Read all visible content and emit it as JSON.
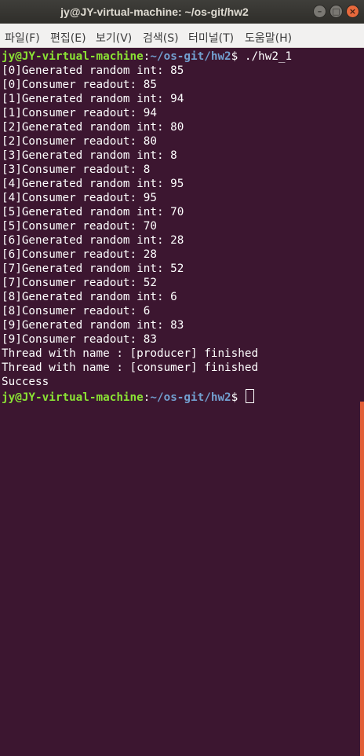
{
  "window": {
    "title": "jy@JY-virtual-machine: ~/os-git/hw2"
  },
  "colors": {
    "background": "#3c1630",
    "prompt_user": "#8ae234",
    "prompt_path": "#729fcf",
    "scrollbar": "#e25f37"
  },
  "menu": {
    "file": "파일(F)",
    "edit": "편집(E)",
    "view": "보기(V)",
    "search": "검색(S)",
    "terminal": "터미널(T)",
    "help": "도움말(H)"
  },
  "prompt": {
    "user_host": "jy@JY-virtual-machine",
    "separator": ":",
    "path": "~/os-git/hw2",
    "symbol": "$ "
  },
  "command": "./hw2_1",
  "output": [
    "[0]Generated random int: 85",
    "[0]Consumer readout: 85",
    "[1]Generated random int: 94",
    "[1]Consumer readout: 94",
    "[2]Generated random int: 80",
    "[2]Consumer readout: 80",
    "[3]Generated random int: 8",
    "[3]Consumer readout: 8",
    "[4]Generated random int: 95",
    "[4]Consumer readout: 95",
    "[5]Generated random int: 70",
    "[5]Consumer readout: 70",
    "[6]Generated random int: 28",
    "[6]Consumer readout: 28",
    "[7]Generated random int: 52",
    "[7]Consumer readout: 52",
    "[8]Generated random int: 6",
    "[8]Consumer readout: 6",
    "[9]Generated random int: 83",
    "[9]Consumer readout: 83",
    "Thread with name : [producer] finished",
    "Thread with name : [consumer] finished",
    "Success"
  ]
}
